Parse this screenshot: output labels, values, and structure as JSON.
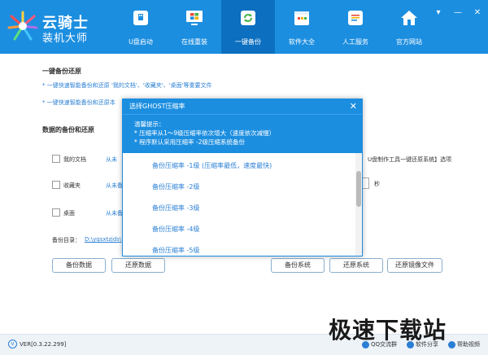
{
  "app": {
    "title": "云骑士",
    "subtitle": "装机大师"
  },
  "nav": [
    {
      "label": "U盘启动",
      "icon": "usb-drive-icon"
    },
    {
      "label": "在线重装",
      "icon": "windows-monitor-icon"
    },
    {
      "label": "一键备份",
      "icon": "backup-refresh-icon"
    },
    {
      "label": "软件大全",
      "icon": "software-box-icon"
    },
    {
      "label": "人工服务",
      "icon": "chat-service-icon"
    },
    {
      "label": "官方网站",
      "icon": "home-icon"
    }
  ],
  "active_nav": "一键备份",
  "window_controls": {
    "menu": "▾",
    "minimize": "—",
    "close": "✕"
  },
  "main": {
    "section1_title": "一键备份还原",
    "tip1": "* 一键快速智能备份和还原 '我的文档'、'收藏夹'、'桌面'等重要文件",
    "tip2": "* 一键快速智能备份和还原本",
    "section2_title": "数据的备份和还原",
    "rows": [
      {
        "label": "我的文档",
        "link": "从未"
      },
      {
        "label": "收藏夹",
        "link": "从未备"
      },
      {
        "label": "桌面",
        "link": "从未备"
      }
    ],
    "right_text": "U盘制作工具一键还原系统】选项",
    "seconds_label": "秒",
    "backup_dir_label": "备份目录：",
    "backup_dir_value": "D:\\yqsxtzjds\\",
    "buttons": {
      "backup_data": "备份数据",
      "restore_data": "还原数据",
      "backup_system": "备份系统",
      "restore_system": "还原系统",
      "restore_image": "还原镜像文件"
    }
  },
  "modal": {
    "title": "选择GHOST压缩率",
    "close": "✕",
    "info_title": "温馨提示：",
    "info_line1": "* 压缩率从1～9级压缩率依次增大（速度依次减慢）",
    "info_line2": "* 程序默认采用压缩率 -2级压缩系统备份",
    "options": [
      "备份压缩率 -1级    (压缩率最低，速度最快)",
      "备份压缩率 -2级",
      "备份压缩率 -3级",
      "备份压缩率 -4级",
      "备份压缩率 -5级"
    ]
  },
  "footer": {
    "version": "VER[0.3.22.299]",
    "qq": "QQ交流群",
    "share": "软件分享",
    "video": "帮助视频"
  },
  "watermark": "极速下载站"
}
